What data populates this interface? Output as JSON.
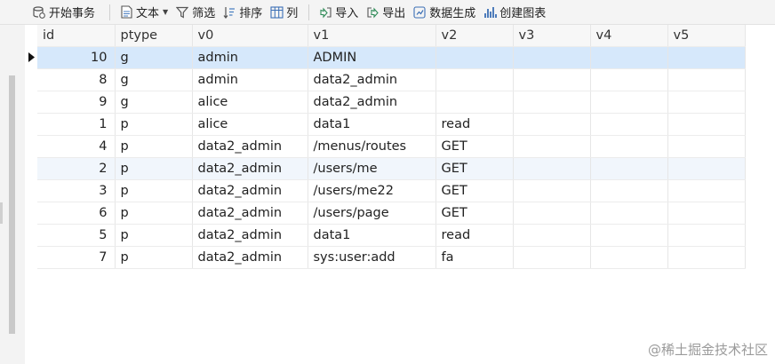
{
  "toolbar": {
    "begin_tx": "开始事务",
    "text": "文本",
    "filter": "筛选",
    "sort": "排序",
    "column": "列",
    "import": "导入",
    "export": "导出",
    "generate_data": "数据生成",
    "create_chart": "创建图表"
  },
  "table": {
    "columns": [
      "id",
      "ptype",
      "v0",
      "v1",
      "v2",
      "v3",
      "v4",
      "v5"
    ],
    "rows": [
      [
        "10",
        "g",
        "admin",
        "ADMIN",
        "",
        "",
        "",
        ""
      ],
      [
        "8",
        "g",
        "admin",
        "data2_admin",
        "",
        "",
        "",
        ""
      ],
      [
        "9",
        "g",
        "alice",
        "data2_admin",
        "",
        "",
        "",
        ""
      ],
      [
        "1",
        "p",
        "alice",
        "data1",
        "read",
        "",
        "",
        ""
      ],
      [
        "4",
        "p",
        "data2_admin",
        "/menus/routes",
        "GET",
        "",
        "",
        ""
      ],
      [
        "2",
        "p",
        "data2_admin",
        "/users/me",
        "GET",
        "",
        "",
        ""
      ],
      [
        "3",
        "p",
        "data2_admin",
        "/users/me22",
        "GET",
        "",
        "",
        ""
      ],
      [
        "6",
        "p",
        "data2_admin",
        "/users/page",
        "GET",
        "",
        "",
        ""
      ],
      [
        "5",
        "p",
        "data2_admin",
        "data1",
        "read",
        "",
        "",
        ""
      ],
      [
        "7",
        "p",
        "data2_admin",
        "sys:user:add",
        "fa",
        "",
        "",
        ""
      ]
    ],
    "selected_row": 0,
    "highlighted_row": 5
  },
  "watermark": "@稀土掘金技术社区"
}
